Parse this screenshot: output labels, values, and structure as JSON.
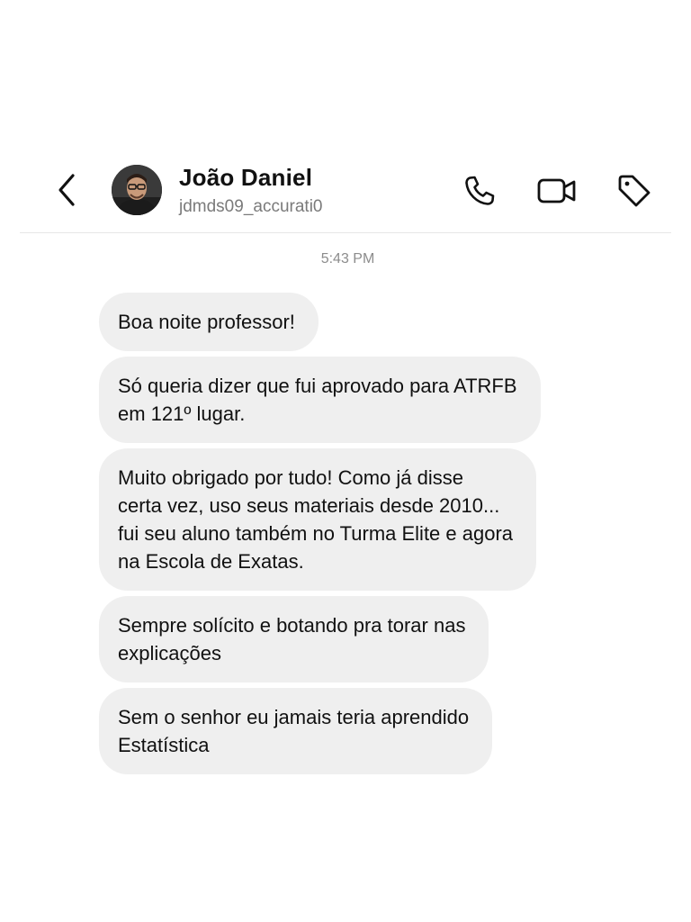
{
  "header": {
    "contact_name": "João Daniel",
    "contact_handle": "jdmds09_accurati0",
    "back_icon": "chevron-left-icon",
    "call_icon": "phone-icon",
    "video_icon": "video-camera-icon",
    "tag_icon": "tag-icon"
  },
  "conversation": {
    "timestamp": "5:43 PM",
    "messages": [
      {
        "lines": [
          "Boa noite professor!"
        ]
      },
      {
        "lines": [
          "Só queria dizer que fui aprovado para ATRFB",
          "em 121º lugar."
        ]
      },
      {
        "lines": [
          "Muito obrigado por tudo! Como já disse",
          "certa vez, uso seus materiais desde 2010...",
          "fui seu aluno também no Turma Elite e agora",
          "na Escola de Exatas."
        ]
      },
      {
        "lines": [
          "Sempre solícito e botando pra torar nas",
          "explicações"
        ]
      },
      {
        "lines": [
          "Sem o senhor eu jamais teria aprendido",
          "Estatística"
        ]
      }
    ]
  },
  "colors": {
    "bubble_background": "#efefef",
    "secondary_text": "#7a7a7a",
    "primary_text": "#111111"
  }
}
